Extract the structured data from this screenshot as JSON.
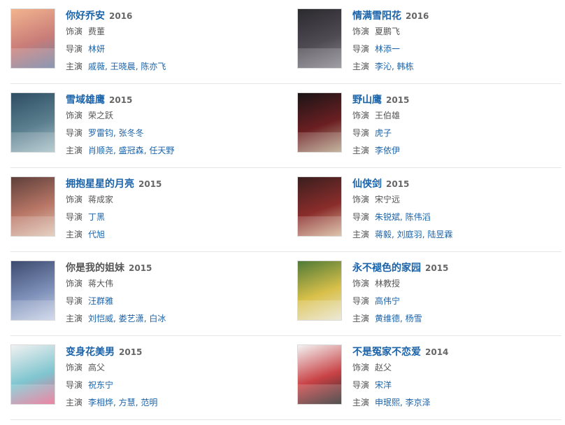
{
  "labels": {
    "role": "饰演",
    "director": "导演",
    "cast": "主演"
  },
  "items": [
    {
      "title": "你好乔安",
      "title_link": true,
      "year": "2016",
      "role": "费董",
      "director": [
        "林妍"
      ],
      "cast": [
        "戚薇",
        "王晓晨",
        "陈亦飞"
      ],
      "poster_colors": [
        "#f2b48f",
        "#c97d78",
        "#6f7fa3"
      ]
    },
    {
      "title": "情满雪阳花",
      "title_link": true,
      "year": "2016",
      "role": "夏鹏飞",
      "director": [
        "林添一"
      ],
      "cast": [
        "李沁",
        "韩栋"
      ],
      "poster_colors": [
        "#2b2a2f",
        "#4e4b52",
        "#8b8892"
      ]
    },
    {
      "title": "雪域雄鹰",
      "title_link": true,
      "year": "2015",
      "role": "荣之跃",
      "director": [
        "罗雷钧",
        "张冬冬"
      ],
      "cast": [
        "肖顺尧",
        "盛冠森",
        "任天野"
      ],
      "poster_colors": [
        "#2e4e63",
        "#5b7f8f",
        "#a9c2c9"
      ]
    },
    {
      "title": "野山鹰",
      "title_link": true,
      "year": "2015",
      "role": "王伯雄",
      "director": [
        "虎子"
      ],
      "cast": [
        "李依伊"
      ],
      "poster_colors": [
        "#1a1416",
        "#6b1f22",
        "#b8a58a"
      ]
    },
    {
      "title": "拥抱星星的月亮",
      "title_link": true,
      "year": "2015",
      "role": "蒋成家",
      "director": [
        "丁黑"
      ],
      "cast": [
        "代旭"
      ],
      "poster_colors": [
        "#5e3f3a",
        "#b97767",
        "#e0c6b4"
      ]
    },
    {
      "title": "仙侠剑",
      "title_link": true,
      "year": "2015",
      "role": "宋宁远",
      "director": [
        "朱锐斌",
        "陈伟滔"
      ],
      "cast": [
        "蒋毅",
        "刘庭羽",
        "陆昱霖"
      ],
      "poster_colors": [
        "#3a1e1e",
        "#8a2d2b",
        "#d7b79a"
      ]
    },
    {
      "title": "你是我的姐妹",
      "title_link": false,
      "year": "2015",
      "role": "蒋大伟",
      "director": [
        "汪群雅"
      ],
      "cast": [
        "刘恺威",
        "娄艺潇",
        "白冰"
      ],
      "poster_colors": [
        "#3c4a6e",
        "#7d8fb8",
        "#c9d3e8"
      ]
    },
    {
      "title": "永不褪色的家园",
      "title_link": true,
      "year": "2015",
      "role": "林教授",
      "director": [
        "高伟宁"
      ],
      "cast": [
        "黄维德",
        "杨雪"
      ],
      "poster_colors": [
        "#4f7a37",
        "#d9c04a",
        "#e9e4cf"
      ]
    },
    {
      "title": "变身花美男",
      "title_link": true,
      "year": "2015",
      "role": "高父",
      "director": [
        "祝东宁"
      ],
      "cast": [
        "李相烨",
        "方慧",
        "范明"
      ],
      "poster_colors": [
        "#f1f1f1",
        "#7fc5cf",
        "#e86a8f"
      ]
    },
    {
      "title": "不是冤家不恋爱",
      "title_link": true,
      "year": "2014",
      "role": "赵父",
      "director": [
        "宋洋"
      ],
      "cast": [
        "申珉熙",
        "李京泽"
      ],
      "poster_colors": [
        "#f3f3f3",
        "#c94346",
        "#2b2b2b"
      ]
    }
  ]
}
